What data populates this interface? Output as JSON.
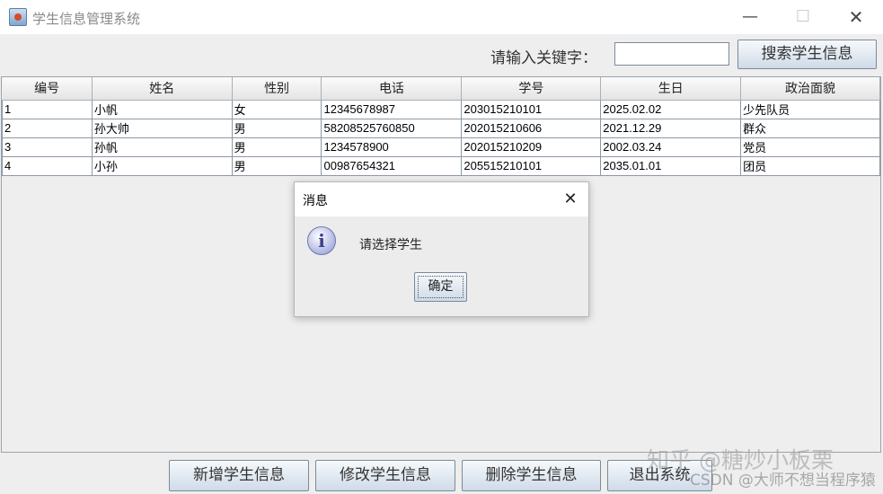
{
  "window": {
    "title": "学生信息管理系统",
    "minimize_glyph": "—",
    "maximize_glyph": "☐",
    "close_glyph": "✕"
  },
  "search": {
    "label": "请输入关键字：",
    "value": "",
    "button_label": "搜索学生信息"
  },
  "table": {
    "columns": [
      "编号",
      "姓名",
      "性别",
      "电话",
      "学号",
      "生日",
      "政治面貌"
    ],
    "rows": [
      [
        "1",
        "小帆",
        "女",
        "12345678987",
        "203015210101",
        "2025.02.02",
        "少先队员"
      ],
      [
        "2",
        "孙大帅",
        "男",
        "58208525760850",
        "202015210606",
        "2021.12.29",
        "群众"
      ],
      [
        "3",
        "孙帆",
        "男",
        "1234578900",
        "202015210209",
        "2002.03.24",
        "党员"
      ],
      [
        "4",
        "小孙",
        "男",
        "00987654321",
        "205515210101",
        "2035.01.01",
        "团员"
      ]
    ]
  },
  "dialog": {
    "title": "消息",
    "close_glyph": "✕",
    "icon_glyph": "i",
    "message": "请选择学生",
    "ok_label": "确定"
  },
  "actions": {
    "add_label": "新增学生信息",
    "edit_label": "修改学生信息",
    "delete_label": "删除学生信息",
    "exit_label": "退出系统"
  },
  "watermark": {
    "zhihu": "知乎 @糖炒小板栗",
    "csdn": "CSDN @大师不想当程序猿"
  }
}
